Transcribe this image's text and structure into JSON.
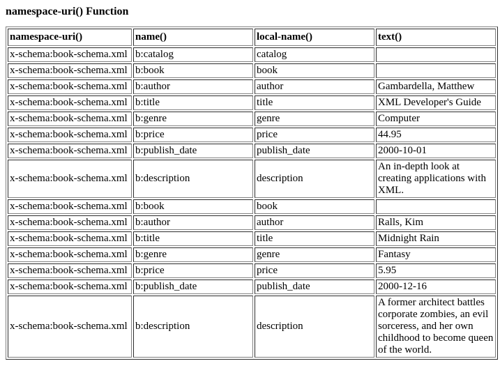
{
  "heading": "namespace-uri() Function",
  "headers": [
    "namespace-uri()",
    "name()",
    "local-name()",
    "text()"
  ],
  "rows": [
    [
      "x-schema:book-schema.xml",
      "b:catalog",
      "catalog",
      ""
    ],
    [
      "x-schema:book-schema.xml",
      "b:book",
      "book",
      ""
    ],
    [
      "x-schema:book-schema.xml",
      "b:author",
      "author",
      "Gambardella, Matthew"
    ],
    [
      "x-schema:book-schema.xml",
      "b:title",
      "title",
      "XML Developer's Guide"
    ],
    [
      "x-schema:book-schema.xml",
      "b:genre",
      "genre",
      "Computer"
    ],
    [
      "x-schema:book-schema.xml",
      "b:price",
      "price",
      "44.95"
    ],
    [
      "x-schema:book-schema.xml",
      "b:publish_date",
      "publish_date",
      "2000-10-01"
    ],
    [
      "x-schema:book-schema.xml",
      "b:description",
      "description",
      "An in-depth look at creating applications with XML."
    ],
    [
      "x-schema:book-schema.xml",
      "b:book",
      "book",
      ""
    ],
    [
      "x-schema:book-schema.xml",
      "b:author",
      "author",
      "Ralls, Kim"
    ],
    [
      "x-schema:book-schema.xml",
      "b:title",
      "title",
      "Midnight Rain"
    ],
    [
      "x-schema:book-schema.xml",
      "b:genre",
      "genre",
      "Fantasy"
    ],
    [
      "x-schema:book-schema.xml",
      "b:price",
      "price",
      "5.95"
    ],
    [
      "x-schema:book-schema.xml",
      "b:publish_date",
      "publish_date",
      "2000-12-16"
    ],
    [
      "x-schema:book-schema.xml",
      "b:description",
      "description",
      "A former architect battles corporate zombies, an evil sorceress, and her own childhood to become queen of the world."
    ]
  ]
}
